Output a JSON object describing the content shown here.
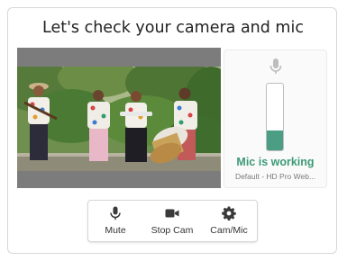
{
  "header": {
    "title": "Let's check your camera and mic"
  },
  "video_preview": {
    "description_icon": "camera-preview"
  },
  "mic_panel": {
    "icon": "microphone-icon",
    "level_fraction": 0.3,
    "status": "Mic is working",
    "device": "Default - HD Pro Web...",
    "status_color": "#3c9a77",
    "meter_color": "#4b9e83"
  },
  "controls": {
    "mute_label": "Mute",
    "stop_cam_label": "Stop Cam",
    "cam_mic_label": "Cam/Mic"
  }
}
